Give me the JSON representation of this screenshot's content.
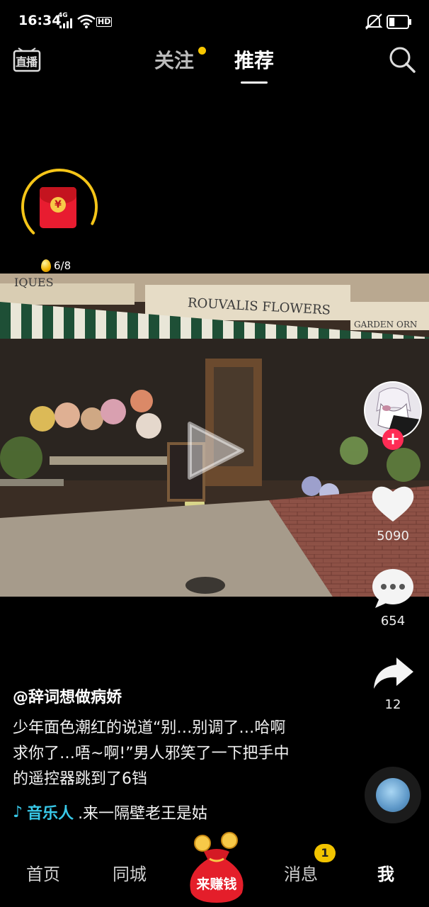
{
  "status_bar": {
    "time": "16:34",
    "network": "4G",
    "hd": "HD",
    "icons": [
      "signal-icon",
      "wifi-icon",
      "hd-icon",
      "mute-icon",
      "battery-icon"
    ],
    "battery_level": 0.3
  },
  "top_nav": {
    "live_label": "直播",
    "tabs": [
      {
        "label": "关注",
        "active": false,
        "has_dot": true
      },
      {
        "label": "推荐",
        "active": true
      }
    ]
  },
  "redpack": {
    "count": "6/8",
    "progress": 0.7,
    "symbol": "¥"
  },
  "video": {
    "sign_text": "ROUVALIS FLOWERS",
    "sign_left": "IQUES",
    "sign_right": "GARDEN ORN"
  },
  "right_rail": {
    "likes": "5090",
    "comments": "654",
    "shares": "12",
    "follow_symbol": "+"
  },
  "post": {
    "author": "@辞词想做病娇",
    "caption_lines": [
      "少年面色潮红的说道“别…别调了…哈啊",
      "求你了…唔~啊!”男人邪笑了一下把手中",
      "的遥控器跳到了6铛"
    ],
    "music_tag": "音乐人",
    "music_title": ".来一隔壁老王是姑"
  },
  "bottom_nav": {
    "items": [
      "首页",
      "同城",
      "消息",
      "我"
    ],
    "earn_label": "来赚钱",
    "message_badge": "1"
  },
  "colors": {
    "accent_red": "#fe2c55",
    "badge_yellow": "#f2c400",
    "music_blue": "#38c8e8",
    "ring_yellow": "#f5c518"
  }
}
